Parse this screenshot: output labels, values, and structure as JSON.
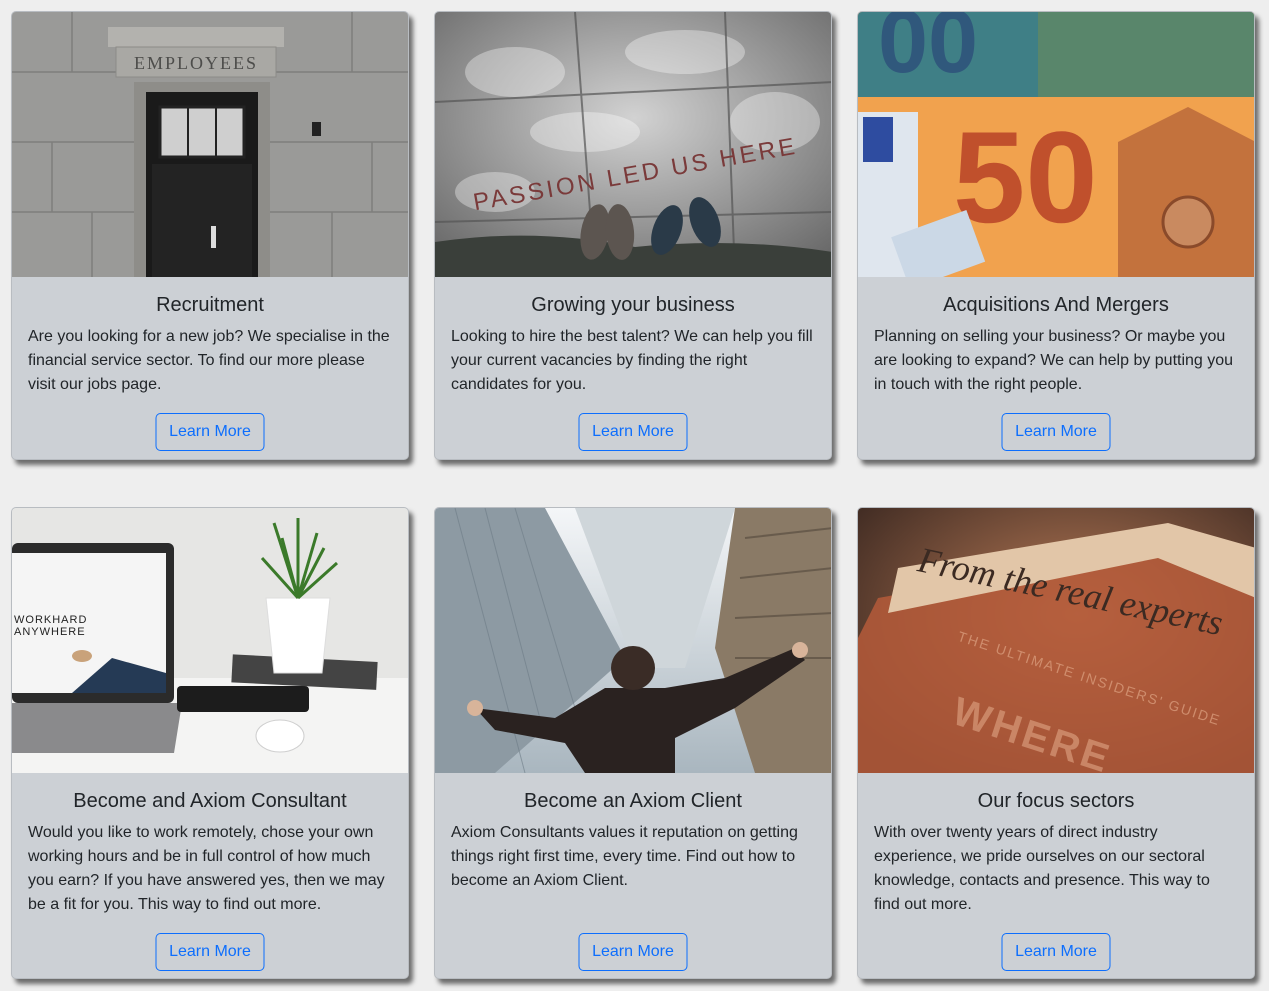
{
  "cards": [
    {
      "title": "Recruitment",
      "text": "Are you looking for a new job? We specialise in the financial service sector. To find our more please visit our jobs page.",
      "button": "Learn More",
      "image_text": "EMPLOYEES"
    },
    {
      "title": "Growing your business",
      "text": "Looking to hire the best talent? We can help you fill your current vacancies by finding the right candidates for you.",
      "button": "Learn More",
      "image_text": "PASSION LED US HERE"
    },
    {
      "title": "Acquisitions And Mergers",
      "text": "Planning on selling your business? Or maybe you are looking to expand? We can help by putting you in touch with the right people.",
      "button": "Learn More",
      "image_text": "50"
    },
    {
      "title": "Become and Axiom Consultant",
      "text": "Would you like to work remotely, chose your own working hours and be in full control of how much you earn? If you have answered yes, then we may be a fit for you. This way to find out more.",
      "button": "Learn More",
      "image_text": "WORKHARD ANYWHERE"
    },
    {
      "title": "Become an Axiom Client",
      "text": "Axiom Consultants values it reputation on getting things right first time, every time. Find out how to become an Axiom Client.",
      "button": "Learn More"
    },
    {
      "title": "Our focus sectors",
      "text": "With over twenty years of direct industry experience, we pride ourselves on our sectoral knowledge, contacts and presence. This way to find out more.",
      "button": "Learn More",
      "image_text": "From the real experts"
    }
  ],
  "colors": {
    "page_background": "#eeeeee",
    "card_background": "#ccd0d5",
    "button_accent": "#0d6efd"
  }
}
